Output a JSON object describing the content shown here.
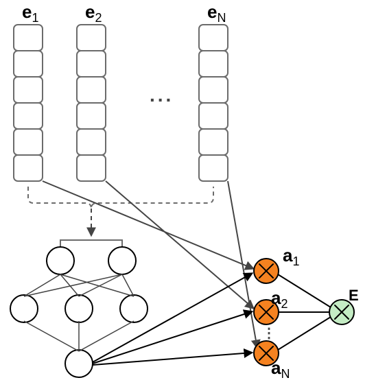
{
  "diagram": {
    "embeddings": {
      "e1": {
        "base": "e",
        "sub": "1"
      },
      "e2": {
        "base": "e",
        "sub": "2"
      },
      "eN": {
        "base": "e",
        "sub": "N"
      },
      "ellipsis": "...",
      "cells_per_vector": 6
    },
    "attn": {
      "a1": {
        "base": "a",
        "sub": "1"
      },
      "a2": {
        "base": "a",
        "sub": "2"
      },
      "aN": {
        "base": "a",
        "sub": "N"
      },
      "vdots": "⋮"
    },
    "output": {
      "label": "E"
    },
    "nn": {
      "layers": [
        2,
        3,
        1
      ]
    }
  }
}
